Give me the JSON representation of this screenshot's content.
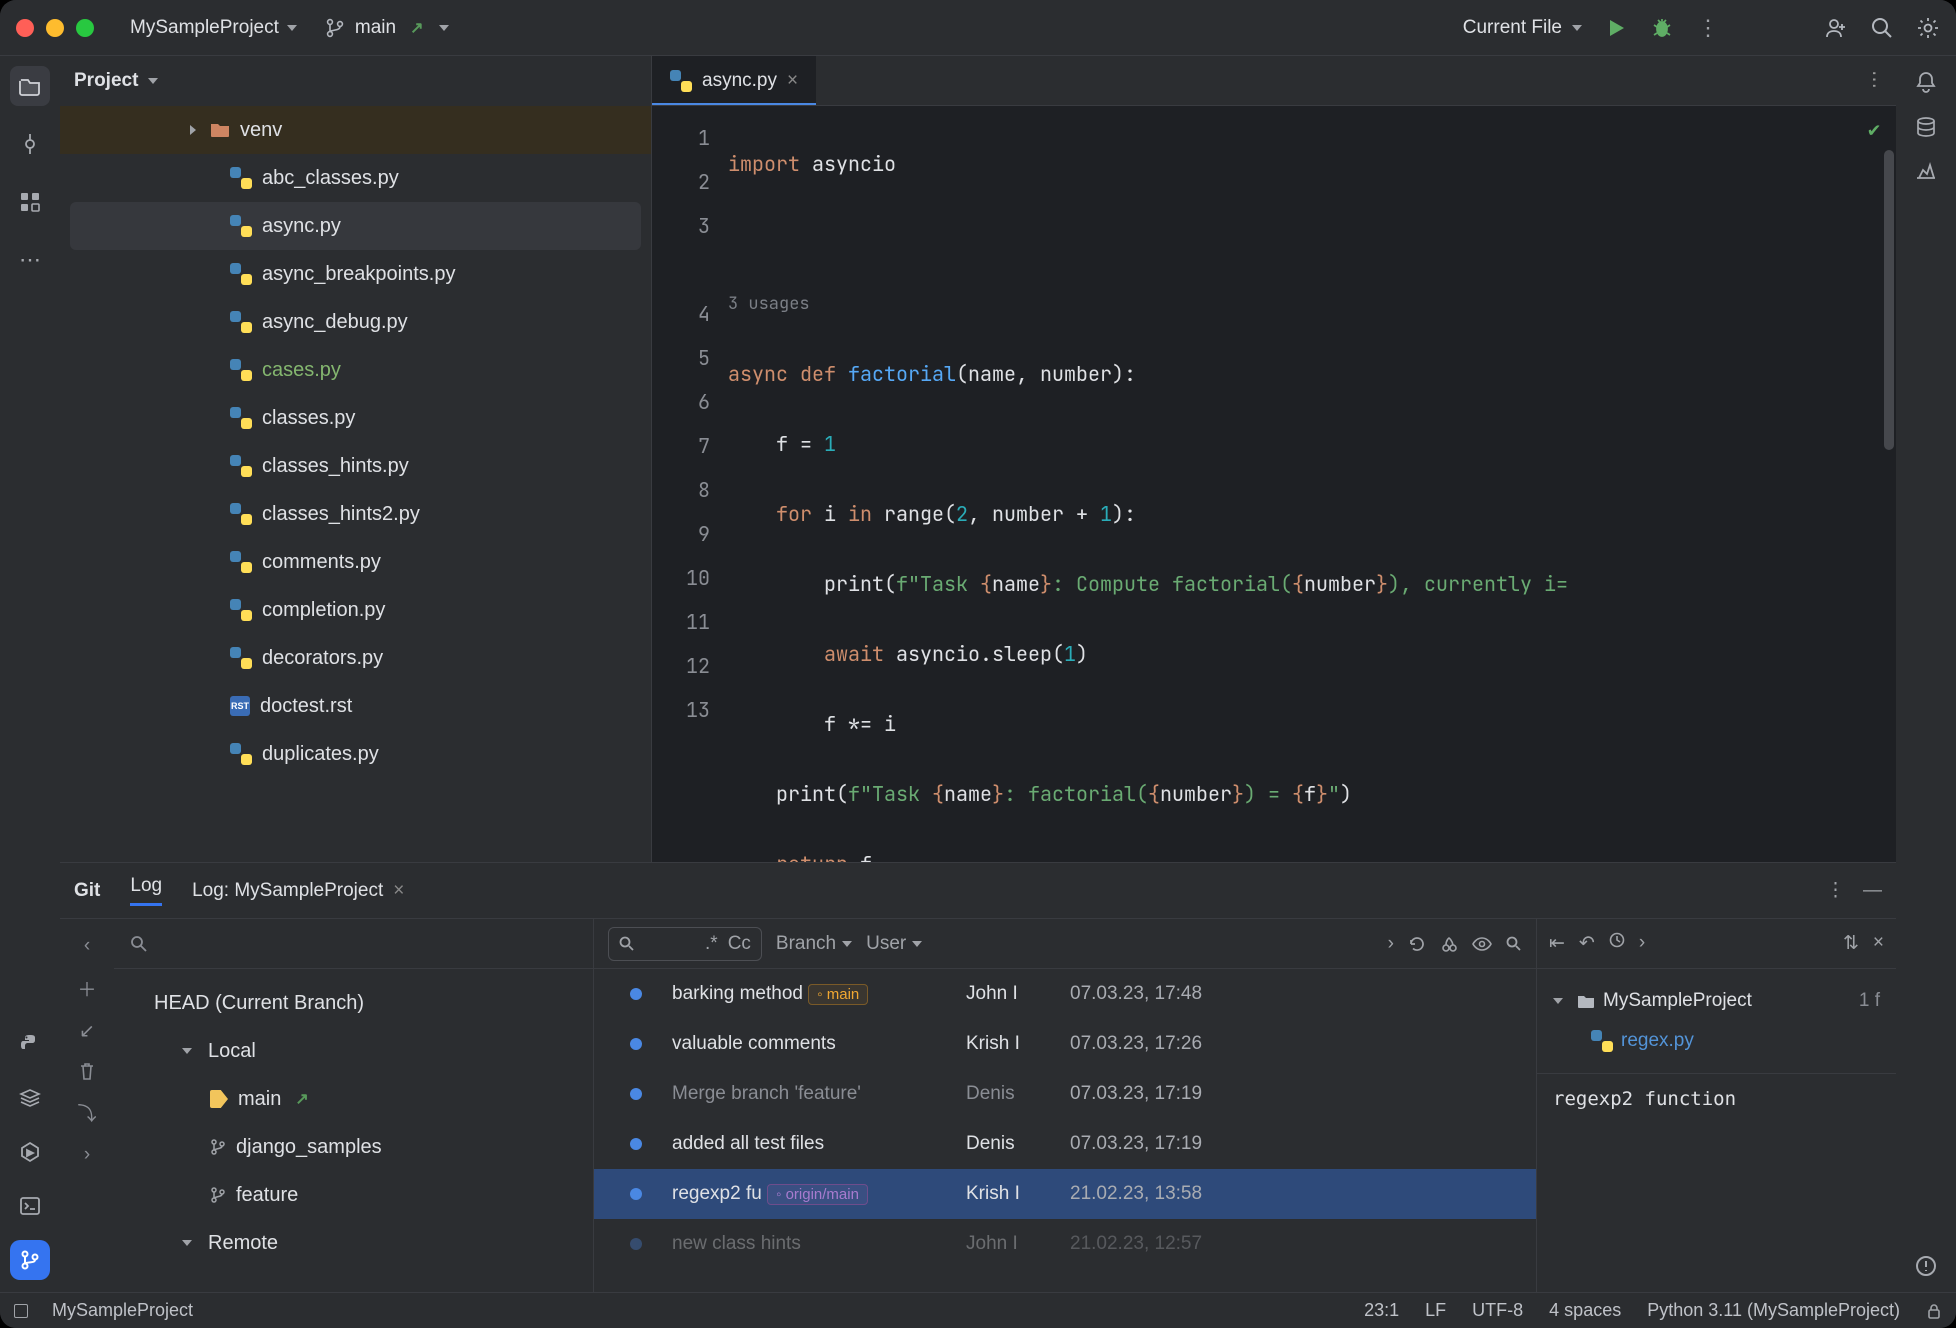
{
  "titlebar": {
    "project": "MySampleProject",
    "branch": "main",
    "run_target": "Current File"
  },
  "project_panel": {
    "title": "Project",
    "folder": "venv",
    "files": [
      "abc_classes.py",
      "async.py",
      "async_breakpoints.py",
      "async_debug.py",
      "cases.py",
      "classes.py",
      "classes_hints.py",
      "classes_hints2.py",
      "comments.py",
      "completion.py",
      "decorators.py",
      "doctest.rst",
      "duplicates.py"
    ],
    "selected": "async.py",
    "vcs_colored": "cases.py"
  },
  "editor": {
    "tab": "async.py",
    "usages": "3 usages",
    "lines": [
      "1",
      "2",
      "3",
      "4",
      "5",
      "6",
      "7",
      "8",
      "9",
      "10",
      "11",
      "12",
      "13"
    ],
    "code": {
      "l1a": "import",
      "l1b": " asyncio",
      "l4a": "async def ",
      "l4b": "factorial",
      "l4c": "(name, number):",
      "l5a": "    f = ",
      "l5b": "1",
      "l6a": "    ",
      "l6b": "for ",
      "l6c": "i ",
      "l6d": "in ",
      "l6e": "range(",
      "l6f": "2",
      "l6g": ", number + ",
      "l6h": "1",
      "l6i": "):",
      "l7a": "        print(",
      "l7b": "f\"Task ",
      "l7c": "{",
      "l7d": "name",
      "l7e": "}",
      "l7f": ": Compute factorial(",
      "l7g": "{",
      "l7h": "number",
      "l7i": "}",
      "l7j": "), currently i=",
      "l8a": "        ",
      "l8b": "await ",
      "l8c": "asyncio.sleep(",
      "l8d": "1",
      "l8e": ")",
      "l9": "        f *= i",
      "l10a": "    print(",
      "l10b": "f\"Task ",
      "l10c": "{",
      "l10d": "name",
      "l10e": "}",
      "l10f": ": factorial(",
      "l10g": "{",
      "l10h": "number",
      "l10i": "}",
      "l10j": ") = ",
      "l10k": "{",
      "l10l": "f",
      "l10m": "}",
      "l10n": "\"",
      "l10o": ")",
      "l11a": "    ",
      "l11b": "return ",
      "l11c": "f"
    }
  },
  "git": {
    "tabs": {
      "git": "Git",
      "log": "Log",
      "log_project": "Log: MySampleProject"
    },
    "branches": {
      "head": "HEAD (Current Branch)",
      "local": "Local",
      "main": "main",
      "django": "django_samples",
      "feature": "feature",
      "remote": "Remote"
    },
    "toolbar": {
      "regex": ".*",
      "cc": "Cc",
      "branch": "Branch",
      "user": "User"
    },
    "commits": [
      {
        "msg": "barking method",
        "badge": "main",
        "badge_cls": "main",
        "author": "John I",
        "date": "07.03.23, 17:48"
      },
      {
        "msg": "valuable comments",
        "author": "Krish I",
        "date": "07.03.23, 17:26"
      },
      {
        "msg": "Merge branch 'feature'",
        "author": "Denis",
        "date": "07.03.23, 17:19",
        "merge": true
      },
      {
        "msg": "added all test files",
        "author": "Denis",
        "date": "07.03.23, 17:19"
      },
      {
        "msg": "regexp2 fu",
        "badge": "origin/main",
        "badge_cls": "origin",
        "author": "Krish I",
        "date": "21.02.23, 13:58",
        "sel": true
      },
      {
        "msg": "new class hints",
        "author": "John I",
        "date": "21.02.23, 12:57",
        "faded": true
      }
    ],
    "detail": {
      "project": "MySampleProject",
      "count": "1 f",
      "file": "regex.py",
      "message": "regexp2 function"
    }
  },
  "status": {
    "project": "MySampleProject",
    "pos": "23:1",
    "eol": "LF",
    "enc": "UTF-8",
    "indent": "4 spaces",
    "python": "Python 3.11 (MySampleProject)"
  }
}
